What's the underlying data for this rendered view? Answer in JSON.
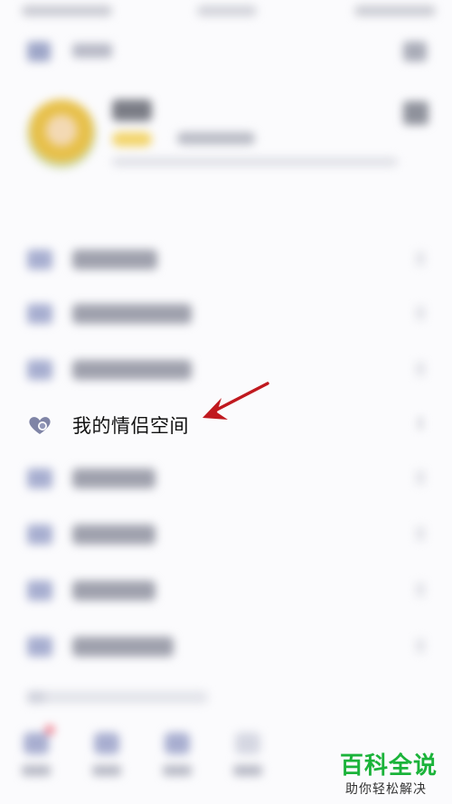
{
  "menu": {
    "highlighted_item": {
      "label": "我的情侣空间",
      "icon": "heart-icon",
      "icon_color": "#7f84a6"
    }
  },
  "annotation": {
    "arrow_color": "#c0191f"
  },
  "watermark": {
    "title": "百科全说",
    "subtitle": "助你轻松解决",
    "color": "#1bb33a"
  }
}
